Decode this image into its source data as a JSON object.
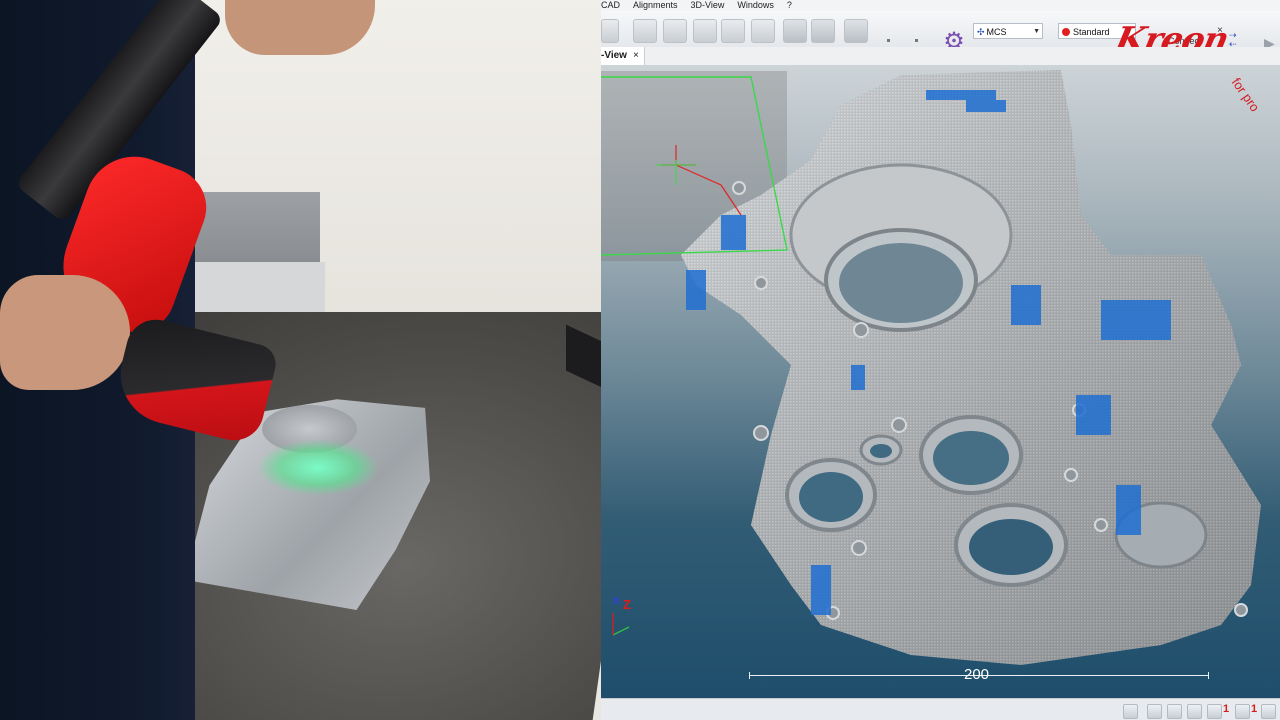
{
  "menu": {
    "items": [
      "CAD",
      "Alignments",
      "3D-View",
      "Windows",
      "?"
    ]
  },
  "toolbar": {
    "coordinate_system": "MCS",
    "profile": "Standard",
    "connect_label": "Connect",
    "close_glyph": "×",
    "brand": "Kreon",
    "icons": [
      "selection-icon",
      "box-icon",
      "cylinder-icon",
      "cube-icon",
      "multi-cube-icon",
      "diamond-icon",
      "solid-cube-icon",
      "wireframe-cube-icon",
      "cross-arrows-icon",
      "point-icon",
      "point-icon",
      "alignment-target-icon"
    ]
  },
  "tabs": [
    {
      "label": "-View",
      "close": "×",
      "active": true
    }
  ],
  "viewport": {
    "watermark": "for pro",
    "scale_value": "200",
    "axis_z": "Z",
    "axis_x": "X",
    "colors": {
      "scan_blue": "#1f6fd1",
      "point_grey": "#c7cbcf",
      "camera_frame": "#3ad84a",
      "probe_line": "#e02424"
    }
  },
  "status": {
    "icons": [
      "grid-icon",
      "view-icon",
      "scan-icon",
      "measure-icon",
      "probe-icon",
      "settings-icon",
      "export-icon"
    ],
    "badges": [
      "1",
      "1"
    ]
  }
}
